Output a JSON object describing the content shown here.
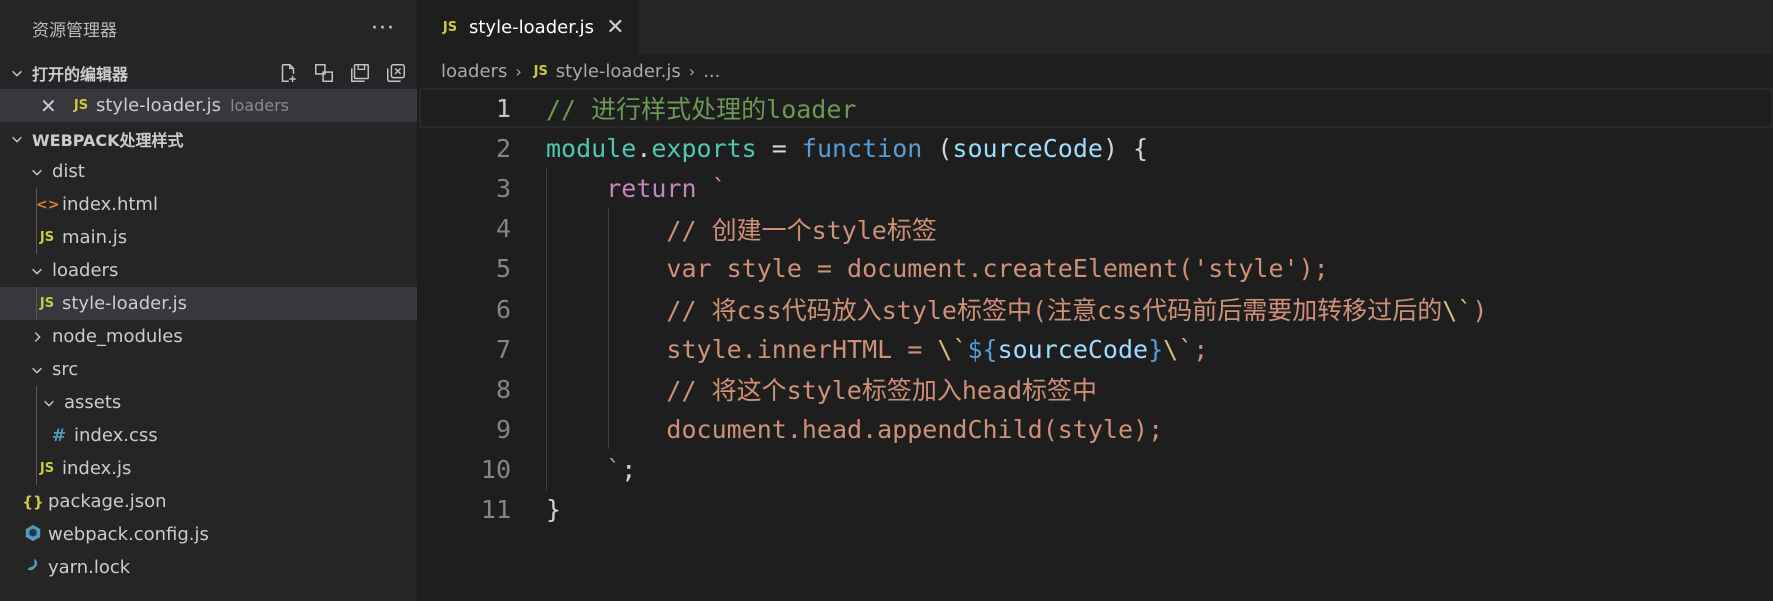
{
  "sidebar": {
    "title": "资源管理器",
    "more": "···",
    "open_editors": {
      "label": "打开的编辑器",
      "items": [
        {
          "name": "style-loader.js",
          "desc": "loaders",
          "icon": "JS"
        }
      ]
    },
    "project": {
      "label": "WEBPACK处理样式",
      "tree": [
        {
          "name": "dist",
          "type": "folder"
        },
        {
          "name": "index.html",
          "icon": "<>"
        },
        {
          "name": "main.js",
          "icon": "JS"
        },
        {
          "name": "loaders",
          "type": "folder"
        },
        {
          "name": "style-loader.js",
          "icon": "JS"
        },
        {
          "name": "node_modules",
          "type": "folder"
        },
        {
          "name": "src",
          "type": "folder"
        },
        {
          "name": "assets",
          "type": "folder"
        },
        {
          "name": "index.css",
          "icon": "#"
        },
        {
          "name": "index.js",
          "icon": "JS"
        },
        {
          "name": "package.json",
          "icon": "{}"
        },
        {
          "name": "webpack.config.js",
          "icon": "webpack-icon"
        },
        {
          "name": "yarn.lock",
          "icon": "yarn-icon"
        }
      ]
    }
  },
  "tab": {
    "icon": "JS",
    "label": "style-loader.js",
    "close": "✕"
  },
  "breadcrumbs": {
    "folder": "loaders",
    "file": "style-loader.js",
    "icon": "JS",
    "ellipsis": "..."
  },
  "code": {
    "line_numbers": [
      "1",
      "2",
      "3",
      "4",
      "5",
      "6",
      "7",
      "8",
      "9",
      "10",
      "11"
    ],
    "l1": {
      "comment": "// 进行样式处理的loader"
    },
    "l2": {
      "module": "module",
      "dot": ".",
      "exports": "exports",
      "eq": " = ",
      "function": "function",
      "paren_open": " (",
      "param": "sourceCode",
      "paren_close": ") {"
    },
    "l3": {
      "return": "return",
      "tick": " `"
    },
    "l4": {
      "text": "// 创建一个style标签"
    },
    "l5": {
      "text": "var style = document.createElement('style');"
    },
    "l6": {
      "text": "// 将css代码放入style标签中(注意css代码前后需要加转移过后的",
      "esc": "\\`",
      "end": ")"
    },
    "l7": {
      "pre": "style.innerHTML = ",
      "esc1": "\\`",
      "interp_open": "${",
      "var": "sourceCode",
      "interp_close": "}",
      "esc2": "\\`",
      "end": ";"
    },
    "l8": {
      "text": "// 将这个style标签加入head标签中"
    },
    "l9": {
      "text": "document.head.appendChild(style);"
    },
    "l10": {
      "tick": "`",
      "semi": ";"
    },
    "l11": {
      "brace": "}"
    }
  },
  "colors": {
    "comment": "#6a9955",
    "keyword": "#569cd6",
    "control": "#c586c0",
    "string": "#ce9178",
    "variable": "#9cdcfe",
    "property": "#4ec9b0"
  }
}
